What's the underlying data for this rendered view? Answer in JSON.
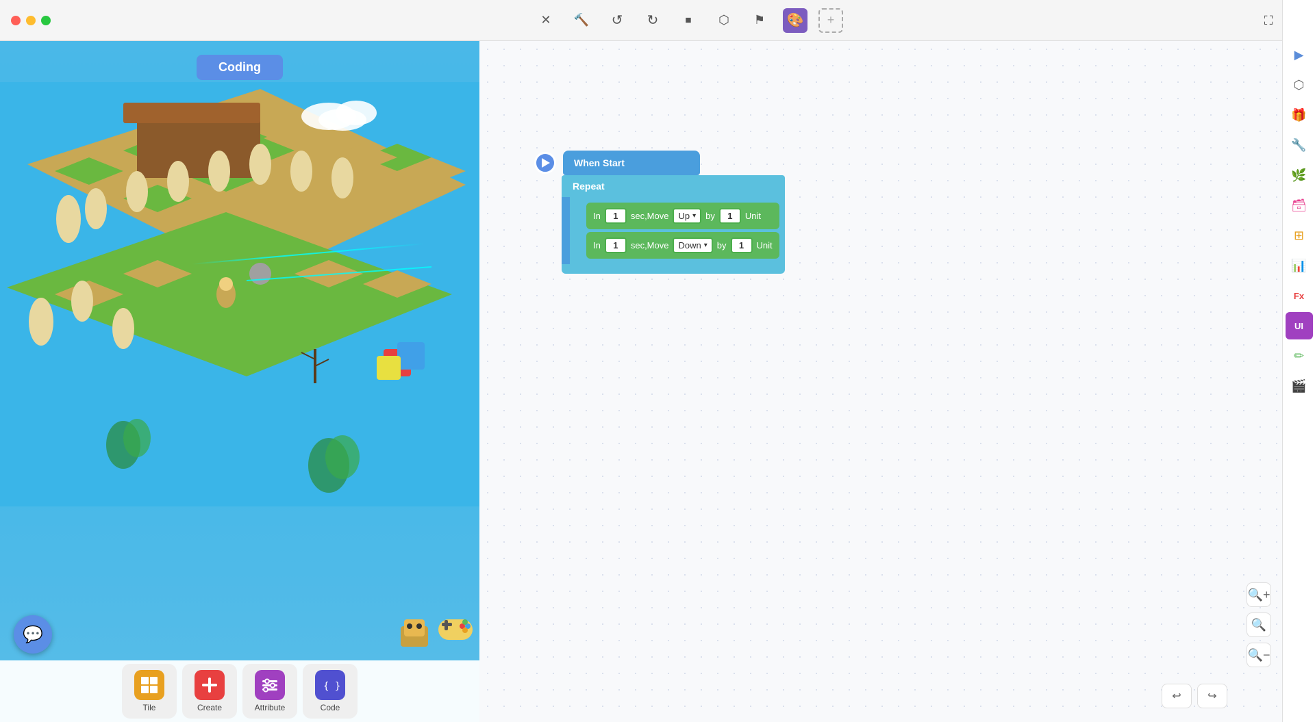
{
  "titlebar": {
    "window_controls": {
      "close": "close",
      "minimize": "minimize",
      "maximize": "maximize"
    },
    "toolbar": {
      "close_label": "✕",
      "wrench_label": "⚙",
      "refresh_label": "↺",
      "redo_label": "↻",
      "stop_label": "■",
      "cube_label": "◈",
      "flag_label": "⚑",
      "paint_label": "🎨",
      "add_label": "+"
    },
    "fullscreen_label": "⛶"
  },
  "right_sidebar": {
    "icons": [
      {
        "name": "cursor-icon",
        "symbol": "▶",
        "active": true
      },
      {
        "name": "link-icon",
        "symbol": "⬡",
        "active": false
      },
      {
        "name": "gift-icon",
        "symbol": "🎁",
        "active": false
      },
      {
        "name": "wrench-icon",
        "symbol": "🔧",
        "active": false
      },
      {
        "name": "leaf-icon",
        "symbol": "🌿",
        "active": false
      },
      {
        "name": "storage-icon",
        "symbol": "🗃",
        "active": false
      },
      {
        "name": "grid-icon",
        "symbol": "⊞",
        "active": false
      },
      {
        "name": "chart-icon",
        "symbol": "📊",
        "active": false
      },
      {
        "name": "fx-icon",
        "symbol": "Fx",
        "active": false
      },
      {
        "name": "ui-icon",
        "symbol": "UI",
        "active": false
      },
      {
        "name": "pen-icon",
        "symbol": "✏",
        "active": false
      },
      {
        "name": "film-icon",
        "symbol": "🎬",
        "active": false
      }
    ]
  },
  "game_area": {
    "coding_label": "Coding"
  },
  "bottom_toolbar": {
    "buttons": [
      {
        "id": "tile",
        "label": "Tile",
        "icon": "⊞",
        "color": "#e8a020"
      },
      {
        "id": "create",
        "label": "Create",
        "icon": "+",
        "color": "#e84040"
      },
      {
        "id": "attribute",
        "label": "Attribute",
        "icon": "≡",
        "color": "#a040c0"
      },
      {
        "id": "code",
        "label": "Code",
        "icon": "{ }",
        "color": "#5050d0"
      }
    ]
  },
  "code_blocks": {
    "when_start": {
      "label": "When Start",
      "play_button": "▶"
    },
    "repeat": {
      "label": "Repeat"
    },
    "move_blocks": [
      {
        "prefix": "In",
        "seconds": "1",
        "action": "sec,Move",
        "direction": "Up",
        "by_label": "by",
        "units": "1",
        "unit_label": "Unit"
      },
      {
        "prefix": "In",
        "seconds": "1",
        "action": "sec,Move",
        "direction": "Down",
        "by_label": "by",
        "units": "1",
        "unit_label": "Unit"
      }
    ]
  },
  "zoom_controls": {
    "zoom_in": "+",
    "zoom_reset": "○",
    "zoom_out": "−"
  },
  "history_controls": {
    "undo": "↩",
    "redo": "↪"
  }
}
